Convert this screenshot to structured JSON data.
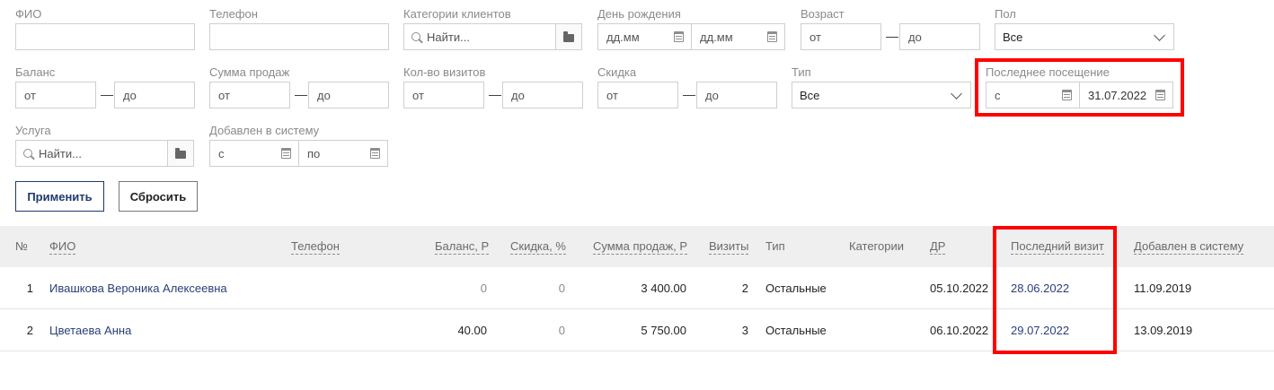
{
  "filters": {
    "fio": {
      "label": "ФИО",
      "value": ""
    },
    "phone": {
      "label": "Телефон",
      "value": ""
    },
    "client_categories": {
      "label": "Категории клиентов",
      "placeholder": "Найти..."
    },
    "birthday": {
      "label": "День рождения",
      "from_placeholder": "дд.мм",
      "to_placeholder": "дд.мм"
    },
    "age": {
      "label": "Возраст",
      "from_placeholder": "от",
      "to_placeholder": "до"
    },
    "gender": {
      "label": "Пол",
      "selected": "Все"
    },
    "balance": {
      "label": "Баланс",
      "from_placeholder": "от",
      "to_placeholder": "до"
    },
    "sales_sum": {
      "label": "Сумма продаж",
      "from_placeholder": "от",
      "to_placeholder": "до"
    },
    "visits_count": {
      "label": "Кол-во визитов",
      "from_placeholder": "от",
      "to_placeholder": "до"
    },
    "discount": {
      "label": "Скидка",
      "from_placeholder": "от",
      "to_placeholder": "до"
    },
    "type": {
      "label": "Тип",
      "selected": "Все"
    },
    "last_visit": {
      "label": "Последнее посещение",
      "from_placeholder": "с",
      "to_value": "31.07.2022"
    },
    "service": {
      "label": "Услуга",
      "placeholder": "Найти..."
    },
    "added": {
      "label": "Добавлен в систему",
      "from_placeholder": "с",
      "to_placeholder": "по"
    },
    "dash": "—"
  },
  "actions": {
    "apply": "Применить",
    "reset": "Сбросить"
  },
  "table": {
    "headers": {
      "num": "№",
      "fio": "ФИО",
      "phone": "Телефон",
      "balance": "Баланс, Р",
      "discount": "Скидка, %",
      "sales": "Сумма продаж, Р",
      "visits": "Визиты",
      "type": "Тип",
      "categories": "Категории",
      "birthday": "ДР",
      "last_visit": "Последний визит",
      "added": "Добавлен в систему"
    },
    "rows": [
      {
        "num": "1",
        "fio": "Ивашкова Вероника Алексеевна",
        "phone": "",
        "balance": "0",
        "discount": "0",
        "sales": "3 400.00",
        "visits": "2",
        "type": "Остальные",
        "categories": "",
        "birthday": "05.10.2022",
        "last_visit": "28.06.2022",
        "added": "11.09.2019"
      },
      {
        "num": "2",
        "fio": "Цветаева Анна",
        "phone": "",
        "balance": "40.00",
        "discount": "0",
        "sales": "5 750.00",
        "visits": "3",
        "type": "Остальные",
        "categories": "",
        "birthday": "06.10.2022",
        "last_visit": "29.07.2022",
        "added": "13.09.2019"
      }
    ]
  },
  "colors": {
    "highlight": "#ff0000",
    "link": "#2a3f7a",
    "primary": "#1e3a6e",
    "header_bg": "#efefef"
  }
}
